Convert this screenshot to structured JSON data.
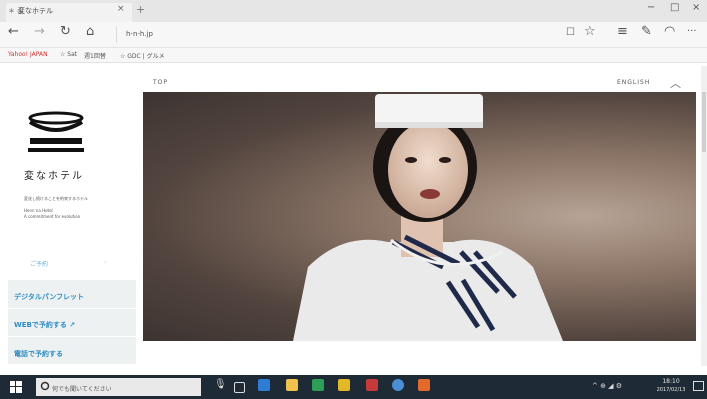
{
  "browser": {
    "tab_title": "変なホテル",
    "tab_favicon": "＊ ◎",
    "tab_close": "×",
    "new_tab": "+",
    "minimize": "−",
    "maximize": "□",
    "close": "×",
    "address": "h-n-h.jp",
    "nav": {
      "back": "←",
      "forward": "→",
      "refresh": "↻",
      "home": "⌂",
      "reading": "☐",
      "favorite": "☆",
      "hub": "≡",
      "note": "✎",
      "share": "◠",
      "more": "···"
    },
    "favorites": [
      "Yahoo! JAPAN",
      "☆ Sat",
      "週1回替",
      "☆ GDC | グルメ"
    ]
  },
  "page": {
    "top_link": "TOP",
    "english_link": "ENGLISH",
    "caret": "︿",
    "hotel_name": "変なホテル",
    "tagline": "変化し続けることを約束するホテル",
    "subtitle_line1": "Henn na Hotel",
    "subtitle_line2": "A commitment for evolution",
    "sub_link": "ご予約",
    "sub_chevron": "›",
    "menu": [
      "デジタルパンフレット",
      "WEBで予約する ↗",
      "電話で予約する"
    ]
  },
  "taskbar": {
    "search_placeholder": "何でも聞いてください",
    "time": "18:10",
    "date": "2017/02/13",
    "tray": "^ ⊕ ◢ ⚙"
  },
  "colors": {
    "menu_text": "#2b8cc4",
    "sub_link": "#6bb3d8",
    "taskbar": "#1e2a36",
    "uniform_scarf_navy": "#1f2a4a"
  }
}
